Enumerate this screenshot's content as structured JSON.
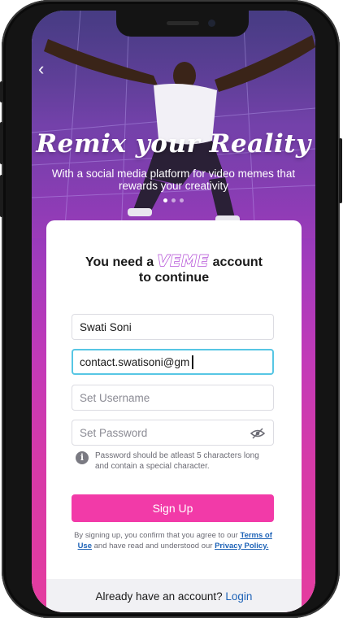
{
  "hero": {
    "title": "Remix your Reality",
    "subtitle": "With a social media platform for video memes that rewards your creativity",
    "carousel_dots": 3,
    "active_dot": 0
  },
  "card": {
    "title_prefix": "You need a",
    "brand": "VEME",
    "title_suffix": "account",
    "title_line2": "to continue"
  },
  "form": {
    "name_value": "Swati Soni",
    "email_value": "contact.swatisoni@gm",
    "username_placeholder": "Set Username",
    "password_placeholder": "Set Password",
    "password_hint": "Password should be atleast 5 characters long and contain a special character."
  },
  "signup": {
    "button_label": "Sign Up",
    "terms_prefix": "By signing up, you confirm that you agree to our",
    "terms_link": "Terms of Use",
    "terms_middle": "and have read and understood our",
    "privacy_link": "Privacy Policy."
  },
  "footer": {
    "already_text": "Already have an account?",
    "login_link": "Login"
  },
  "colors": {
    "accent_pink": "#f23aa8",
    "link_blue": "#1e63b7",
    "focus_cyan": "#57c6e4"
  }
}
